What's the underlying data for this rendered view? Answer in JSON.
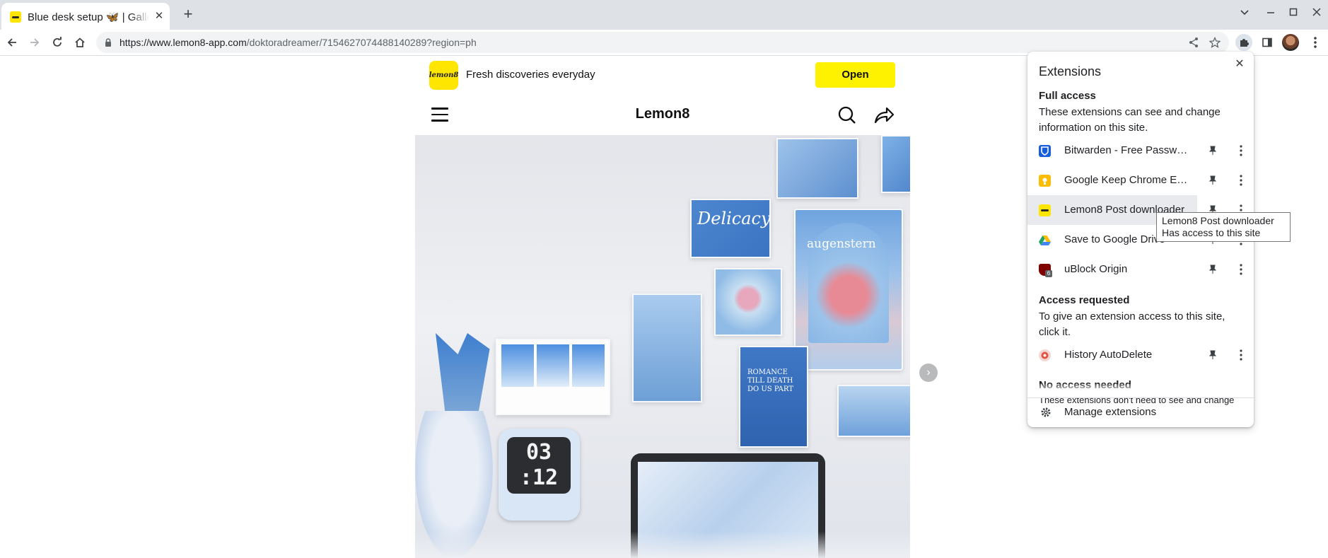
{
  "browser": {
    "tab_title": "Blue desk setup 🦋 | Gallery posted by",
    "tab_close": "✕",
    "new_tab": "+",
    "url_host": "https://www.lemon8-app.com",
    "url_path": "/doktoradreamer/7154627074488140289?region=ph"
  },
  "banner": {
    "logo_text": "lemon8",
    "slogan": "Fresh discoveries everyday",
    "open_label": "Open"
  },
  "site": {
    "title": "Lemon8"
  },
  "photo": {
    "card_delicacy": "Delicacy",
    "card_augenstern": "augenstern",
    "card_romance": "ROMANCE TILL DEATH DO US PART",
    "clock_top": "03",
    "clock_bottom": ":12"
  },
  "extensions": {
    "title": "Extensions",
    "close": "✕",
    "full_access": {
      "heading": "Full access",
      "description": "These extensions can see and change information on this site.",
      "items": [
        {
          "name": "Bitwarden - Free Password Manager",
          "icon": "bitwarden-icon",
          "color": "#175ddc"
        },
        {
          "name": "Google Keep Chrome Extension",
          "icon": "google-keep-icon",
          "color": "#fbbc04"
        },
        {
          "name": "Lemon8 Post downloader",
          "icon": "lemon8-icon",
          "color": "#ffe600"
        },
        {
          "name": "Save to Google Drive",
          "icon": "google-drive-icon",
          "color": "#1fa463"
        },
        {
          "name": "uBlock Origin",
          "icon": "ublock-icon",
          "color": "#800000",
          "badge": "6"
        }
      ]
    },
    "access_requested": {
      "heading": "Access requested",
      "description": "To give an extension access to this site, click it.",
      "items": [
        {
          "name": "History AutoDelete",
          "icon": "history-autodelete-icon",
          "color": "#e25241"
        }
      ]
    },
    "no_access": {
      "heading": "No access needed",
      "partial_description": "These extensions don't need to see and change"
    },
    "manage_label": "Manage extensions"
  },
  "tooltip": {
    "line1": "Lemon8 Post downloader",
    "line2": "Has access to this site"
  }
}
